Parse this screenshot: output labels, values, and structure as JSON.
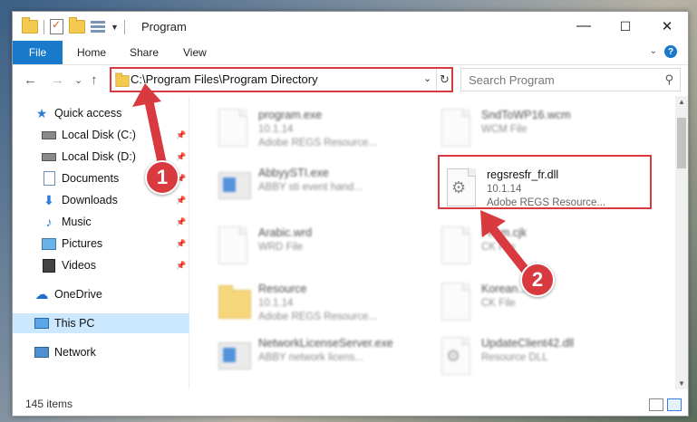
{
  "window": {
    "title": "Program",
    "min": "—",
    "max": "☐",
    "close": "✕"
  },
  "ribbon": {
    "tabs": [
      "File",
      "Home",
      "Share",
      "View"
    ],
    "chevron": "⌄",
    "help": "?"
  },
  "nav": {
    "back": "←",
    "forward": "→",
    "recent": "⌄",
    "up": "↑",
    "address": "C:\\Program Files\\Program Directory",
    "address_dropdown": "⌄",
    "refresh": "↻",
    "search_placeholder": "Search Program",
    "search_icon": "⚲"
  },
  "sidebar": {
    "items": [
      {
        "label": "Quick access",
        "icon": "star-icon"
      },
      {
        "label": "Local Disk (C:)",
        "icon": "drive-icon"
      },
      {
        "label": "Local Disk (D:)",
        "icon": "drive-icon"
      },
      {
        "label": "Documents",
        "icon": "documents-icon"
      },
      {
        "label": "Downloads",
        "icon": "downloads-icon"
      },
      {
        "label": "Music",
        "icon": "music-icon"
      },
      {
        "label": "Pictures",
        "icon": "pictures-icon"
      },
      {
        "label": "Videos",
        "icon": "videos-icon"
      },
      {
        "label": "OneDrive",
        "icon": "cloud-icon"
      },
      {
        "label": "This PC",
        "icon": "computer-icon"
      },
      {
        "label": "Network",
        "icon": "network-icon"
      }
    ],
    "pin": "📌"
  },
  "files": [
    {
      "name": "program.exe",
      "version": "10.1.14",
      "desc": "Adobe REGS Resource...",
      "type": "exe"
    },
    {
      "name": "SndToWP16.wcm",
      "version": "WCM File",
      "desc": "",
      "type": "doc"
    },
    {
      "name": "AbbyySTI.exe",
      "version": "ABBY sti event hand...",
      "desc": "",
      "type": "exe"
    },
    {
      "name": "regsresfr_fr.dll",
      "version": "10.1.14",
      "desc": "Adobe REGS Resource...",
      "type": "dll"
    },
    {
      "name": "Arabic.wrd",
      "version": "WRD File",
      "desc": "",
      "type": "doc"
    },
    {
      "name": "Fi...m.cjk",
      "version": "CK File",
      "desc": "",
      "type": "doc"
    },
    {
      "name": "Resource",
      "version": "10.1.14",
      "desc": "Adobe REGS Resource...",
      "type": "folder"
    },
    {
      "name": "Korean...",
      "version": "CK File",
      "desc": "",
      "type": "doc"
    },
    {
      "name": "NetworkLicenseServer.exe",
      "version": "ABBY network licens...",
      "desc": "",
      "type": "exe"
    },
    {
      "name": "UpdateClient42.dll",
      "version": "Resource DLL",
      "desc": "",
      "type": "dll"
    }
  ],
  "status": {
    "count": "145 items"
  },
  "annotations": {
    "badge1": "1",
    "badge2": "2"
  },
  "colors": {
    "accent": "#1979ca",
    "highlight": "#d83a3f",
    "selection": "#cce8ff"
  }
}
